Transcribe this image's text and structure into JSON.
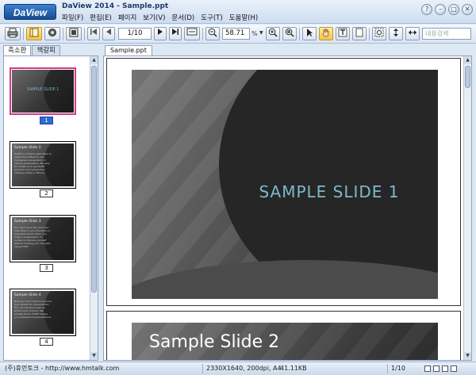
{
  "app": {
    "logo": "DaView",
    "window_title": "DaView 2014 - Sample.ppt"
  },
  "menu": [
    "파일(F)",
    "편집(E)",
    "페이지",
    "보기(V)",
    "문서(D)",
    "도구(T)",
    "도움말(H)"
  ],
  "window_buttons": {
    "help": "?",
    "minimize": "–",
    "maximize": "□",
    "close": "✕"
  },
  "toolbar": {
    "page_field": "1/10",
    "zoom_value": "58.71",
    "zoom_unit": "%",
    "search_placeholder": "내용검색"
  },
  "left_tabs": [
    "축소판",
    "책갈피"
  ],
  "thumbnails": [
    {
      "number": "1",
      "title": "SAMPLE SLIDE 1",
      "selected": true
    },
    {
      "number": "2",
      "title": "Sample Slide 2",
      "body": "HoMT is a mobile application to make more effective and impressive presentation in various presentation. Be easy for audience to see HoMT provides more interactive utilizing of iPad or iPhone."
    },
    {
      "number": "3",
      "title": "Sample Slide 3",
      "body": "You can't touch the recorded note when in your thoughts or important points when you make a presentation in audience. Express yourself without missing your thoughts using HoMT."
    },
    {
      "number": "4",
      "title": "Sample Slide 4",
      "body": "Now you don't need to practice your speech for presentation. You can use the screen as white board function like parallel board. HoMT makes you professional presentations."
    }
  ],
  "document_tab": "Sample.ppt",
  "slides": [
    {
      "title": "SAMPLE SLIDE 1"
    },
    {
      "title": "Sample Slide 2"
    }
  ],
  "status": {
    "company": "(주)휴먼토크 - http://www.hmtalk.com",
    "info": "2330X1640, 200dpi, A4",
    "size": "41.11KB",
    "page": "1/10"
  },
  "colors": {
    "accent": "#2f6bd0",
    "selected_thumb_border": "#d03a88",
    "slide1_title": "#7fb8cc"
  }
}
